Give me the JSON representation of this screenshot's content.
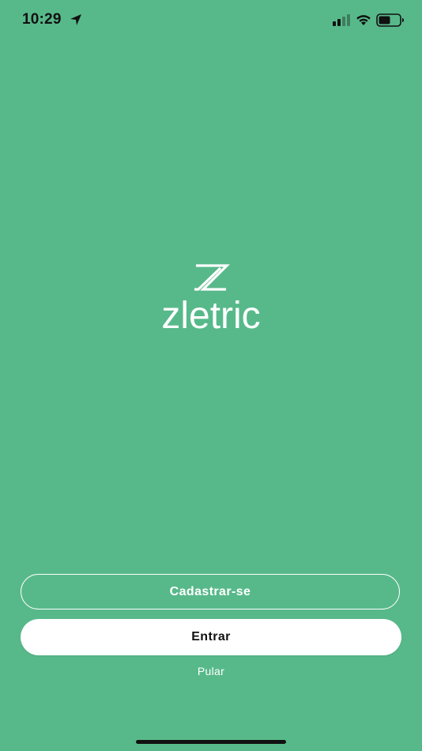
{
  "status_bar": {
    "time": "10:29",
    "icons": {
      "location": "location-arrow-icon",
      "signal": "cellular-signal-icon",
      "wifi": "wifi-icon",
      "battery": "battery-icon"
    }
  },
  "colors": {
    "background": "#57b98a",
    "primary_button_bg": "#ffffff",
    "primary_button_text": "#111111",
    "outline_button_border": "#ffffff",
    "text_light": "#ffffff"
  },
  "logo": {
    "text": "zletric",
    "mark_icon": "zletric-z-logo-icon"
  },
  "actions": {
    "signup_label": "Cadastrar-se",
    "login_label": "Entrar",
    "skip_label": "Pular"
  }
}
